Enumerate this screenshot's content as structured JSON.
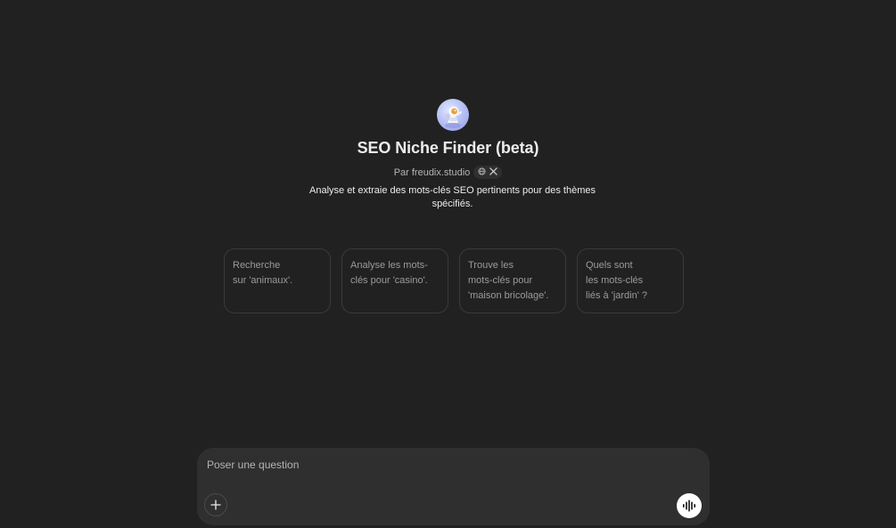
{
  "gpt": {
    "avatar_icon": "astronaut-icon",
    "name": "SEO Niche Finder (beta)",
    "byline": "Par freudix.studio",
    "byline_icons": [
      "globe-icon",
      "x-logo-icon"
    ],
    "description": "Analyse et extraie des mots-clés SEO pertinents pour des thèmes spécifiés."
  },
  "starters": [
    {
      "text": "Recherche\nsur 'animaux'."
    },
    {
      "text": "Analyse les mots-\nclés pour 'casino'."
    },
    {
      "text": "Trouve les\nmots-clés pour\n'maison bricolage'."
    },
    {
      "text": "Quels sont\nles mots-clés\nliés à 'jardin' ?"
    }
  ],
  "composer": {
    "placeholder": "Poser une question",
    "value": "",
    "attach_icon": "plus-icon",
    "voice_icon": "voice-waveform-icon"
  },
  "colors": {
    "background": "#212121",
    "composer": "#2f2f2f",
    "text_primary": "#ececec",
    "text_secondary": "#9b9b9b"
  }
}
